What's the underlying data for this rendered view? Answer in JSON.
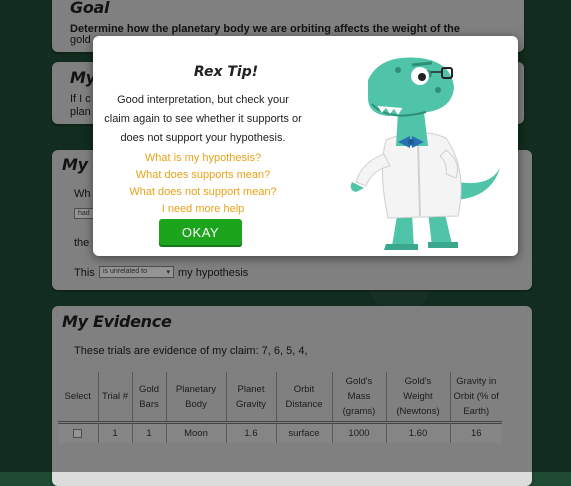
{
  "goal_card": {
    "title": "Goal",
    "text_line1": "Determine how the planetary body we are orbiting affects the weight of the",
    "text_line2": "gold"
  },
  "hypothesis_card": {
    "title_fragment": "My H",
    "text_line1": "If I c",
    "text_line2": "plan"
  },
  "claim_card": {
    "title_fragment": "My Cl",
    "row1_fragment": "Wh",
    "select1": "had",
    "row2_fragment": "the",
    "row3_prefix": "This",
    "select3": "is unrelated to",
    "row3_suffix": "my hypothesis"
  },
  "evidence_card": {
    "title": "My Evidence",
    "intro": "These trials are evidence of my claim: 7, 6, 5, 4,",
    "columns": [
      "Select",
      "Trial #",
      "Gold Bars",
      "Planetary Body",
      "Planet Gravity",
      "Orbit Distance",
      "Gold's Mass (grams)",
      "Gold's Weight (Newtons)",
      "Gravity in Orbit (% of Earth)"
    ],
    "rows": [
      [
        "",
        "1",
        "1",
        "Moon",
        "1.6",
        "surface",
        "1000",
        "1.60",
        "16"
      ]
    ]
  },
  "modal": {
    "title": "Rex Tip!",
    "message": "Good interpretation, but check your claim again to see whether it supports or does not support your hypothesis.",
    "links": [
      "What is my hypothesis?",
      "What does supports mean?",
      "What does not support mean?",
      "I need more help"
    ],
    "ok_label": "Okay",
    "mascot_icon": "dinosaur-scientist-icon"
  },
  "colors": {
    "background": "#204d36",
    "card": "#dcdcdc",
    "link": "#e8a21a",
    "ok_button": "#1ca51c"
  }
}
